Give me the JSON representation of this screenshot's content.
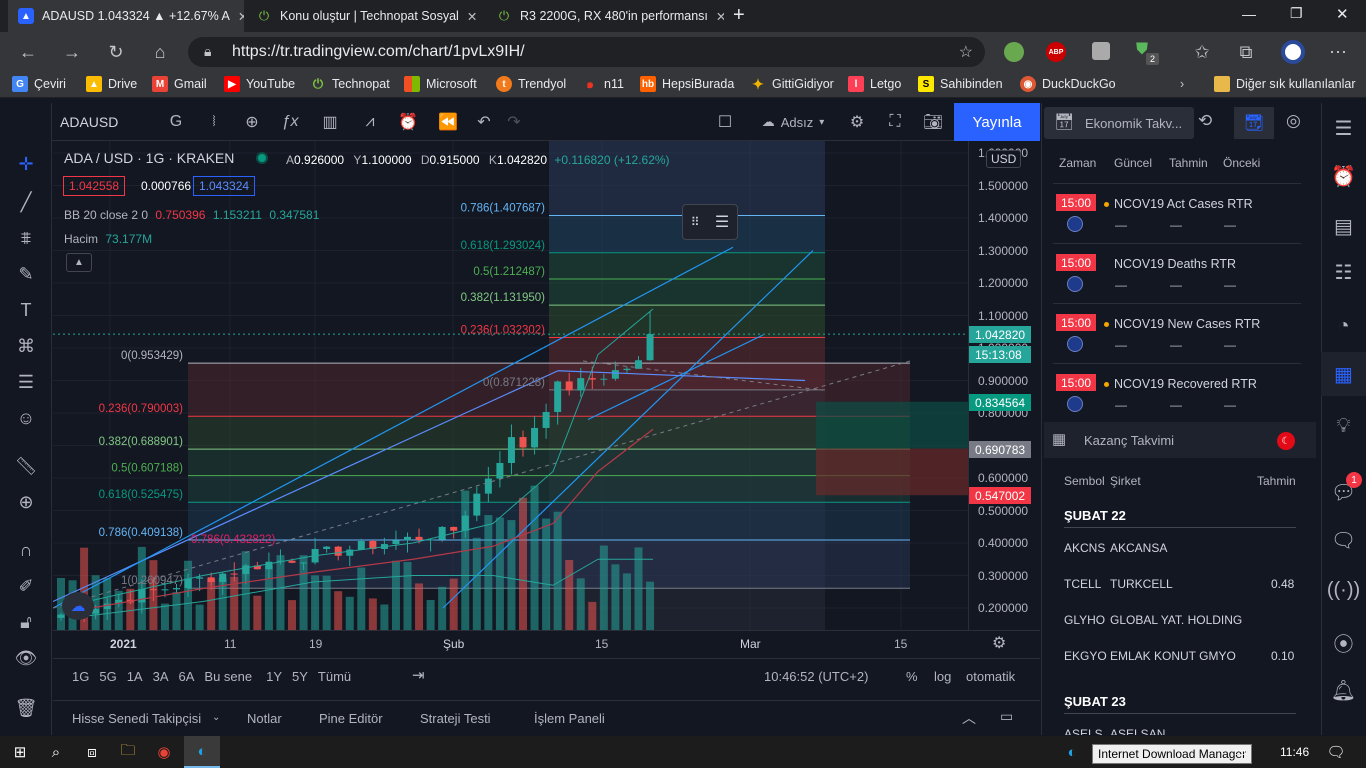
{
  "browser": {
    "tabs": [
      {
        "title": "ADAUSD 1.043324 ▲ +12.67% A",
        "active": true
      },
      {
        "title": "Konu oluştur | Technopat Sosyal",
        "active": false
      },
      {
        "title": "R3 2200G, RX 480'in performansı",
        "active": false
      }
    ],
    "url": "https://tr.tradingview.com/chart/1pvLx9IH/",
    "ext_abp": "ABP",
    "ext_badge": "2",
    "bookmarks": [
      "Çeviri",
      "Drive",
      "Gmail",
      "YouTube",
      "Technopat",
      "Microsoft",
      "Trendyol",
      "n11",
      "HepsiBurada",
      "GittiGidiyor",
      "Letgo",
      "Sahibinden",
      "DuckDuckGo"
    ],
    "bookmarks_other": "Diğer sık kullanılanlar"
  },
  "toolbar": {
    "menu_badge": "2",
    "symbol": "ADAUSD",
    "interval": "G",
    "layout_name": "Adsız",
    "publish_label": "Yayınla"
  },
  "legend": {
    "title": "ADA / USD · 1G · KRAKEN",
    "open_label": "A",
    "open": "0.926000",
    "high_label": "Y",
    "high": "1.100000",
    "low_label": "D",
    "low": "0.915000",
    "close_label": "K",
    "close": "1.042820",
    "change": "+0.116820 (+12.62%)",
    "bid": "1.042558",
    "spread": "0.000766",
    "ask": "1.043324",
    "bb_label": "BB 20 close 2 0",
    "bb_basis": "0.750396",
    "bb_upper": "1.153211",
    "bb_lower": "0.347581",
    "vol_label": "Hacim",
    "vol_value": "73.177M"
  },
  "fib_left": [
    {
      "label": "0(0.953429)",
      "price": 0.953429,
      "color": "#b2b5be"
    },
    {
      "label": "0.236(0.790003)",
      "price": 0.790003,
      "color": "#f23645"
    },
    {
      "label": "0.382(0.688901)",
      "price": 0.688901,
      "color": "#81c784"
    },
    {
      "label": "0.5(0.607188)",
      "price": 0.607188,
      "color": "#4caf50"
    },
    {
      "label": "0.618(0.525475)",
      "price": 0.525475,
      "color": "#089981"
    },
    {
      "label": "0.786(0.409138)",
      "price": 0.409138,
      "color": "#64b5f6"
    },
    {
      "label": "1(0.260947)",
      "price": 0.260947,
      "color": "#787b86"
    }
  ],
  "fib_left_extra": "0.786(0.432822)",
  "fib_right": [
    {
      "label": "0.786(1.407687)",
      "price": 1.407687,
      "color": "#64b5f6"
    },
    {
      "label": "0.618(1.293024)",
      "price": 1.293024,
      "color": "#089981"
    },
    {
      "label": "0.5(1.212487)",
      "price": 1.212487,
      "color": "#4caf50"
    },
    {
      "label": "0.382(1.131950)",
      "price": 1.13195,
      "color": "#81c784"
    },
    {
      "label": "0.236(1.032302)",
      "price": 1.032302,
      "color": "#f23645"
    },
    {
      "label": "0(0.871228)",
      "price": 0.871228,
      "color": "#787b86"
    }
  ],
  "price_axis": {
    "currency": "USD",
    "ticks": [
      "1.600000",
      "1.500000",
      "1.400000",
      "1.300000",
      "1.200000",
      "1.100000",
      "1.000000",
      "0.900000",
      "0.800000",
      "0.700000",
      "0.600000",
      "0.500000",
      "0.400000",
      "0.300000",
      "0.200000"
    ],
    "tick_values": [
      1.6,
      1.5,
      1.4,
      1.3,
      1.2,
      1.1,
      1.0,
      0.9,
      0.8,
      0.7,
      0.6,
      0.5,
      0.4,
      0.3,
      0.2
    ],
    "last_price": "1.042820",
    "countdown": "15:13:08",
    "tag_green": "0.834564",
    "tag_gray": "0.690783",
    "tag_red": "0.547002"
  },
  "time_axis": {
    "labels": [
      "2021",
      "11",
      "19",
      "Şub",
      "15",
      "Mar",
      "15"
    ]
  },
  "range_bar": {
    "ranges": [
      "1G",
      "5G",
      "1A",
      "3A",
      "6A",
      "Bu sene",
      "1Y",
      "5Y",
      "Tümü"
    ],
    "clock": "10:46:52 (UTC+2)",
    "pct": "%",
    "log": "log",
    "auto": "otomatik"
  },
  "bottom_tabs": [
    "Hisse Senedi Takipçisi",
    "Notlar",
    "Pine Editör",
    "Strateji Testi",
    "İşlem Paneli"
  ],
  "econ": {
    "title": "Ekonomik Takv...",
    "columns": [
      "Zaman",
      "Güncel",
      "Tahmin",
      "Önceki"
    ],
    "events": [
      {
        "time": "15:00",
        "name": "NCOV19 Act Cases RTR"
      },
      {
        "time": "15:00",
        "name": "NCOV19 Deaths RTR"
      },
      {
        "time": "15:00",
        "name": "NCOV19 New Cases RTR"
      },
      {
        "time": "15:00",
        "name": "NCOV19 Recovered RTR"
      }
    ],
    "dash": "—"
  },
  "earnings": {
    "title": "Kazanç Takvimi",
    "columns": [
      "Sembol",
      "Şirket",
      "Tahmin"
    ],
    "date1": "ŞUBAT 22",
    "rows": [
      {
        "symbol": "AKCNS",
        "company": "AKCANSA",
        "estimate": ""
      },
      {
        "symbol": "TCELL",
        "company": "TURKCELL",
        "estimate": "0.48"
      },
      {
        "symbol": "GLYHO",
        "company": "GLOBAL YAT. HOLDING",
        "estimate": ""
      },
      {
        "symbol": "EKGYO",
        "company": "EMLAK KONUT GMYO",
        "estimate": "0.10"
      }
    ],
    "date2": "ŞUBAT 23",
    "partial_symbol": "ASELS",
    "partial_company": "ASELSAN"
  },
  "right_bar_badge": "1",
  "taskbar": {
    "time": "11:46",
    "tooltip": "Internet Download Manager"
  },
  "colors": {
    "up": "#26a69a",
    "down": "#ef5350",
    "accent": "#2962ff",
    "bg": "#131722"
  }
}
